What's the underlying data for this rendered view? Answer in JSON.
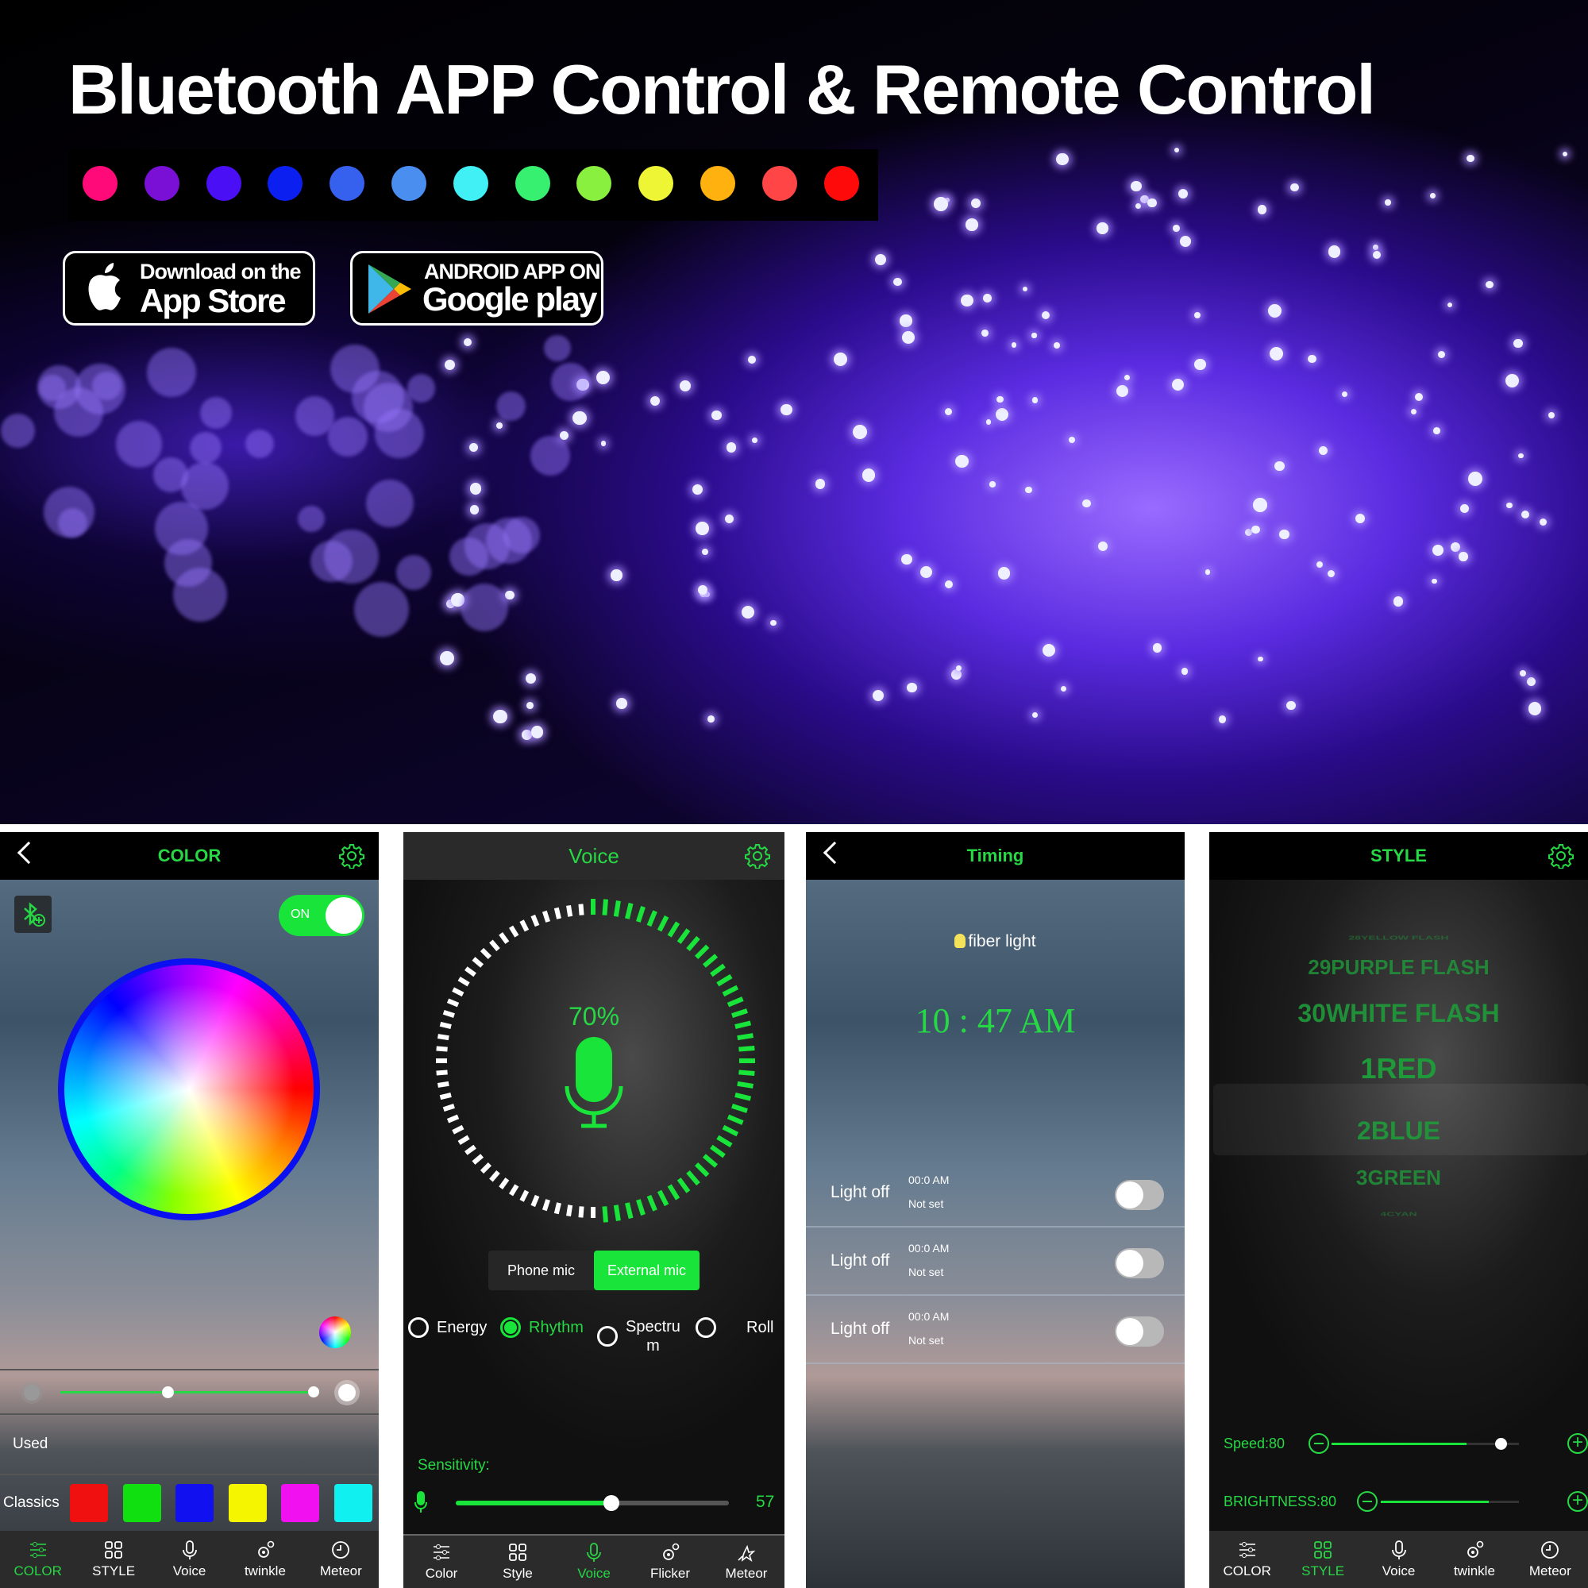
{
  "hero": {
    "title": "Bluetooth APP Control & Remote Control",
    "color_dots": [
      "#ff0a78",
      "#7a0fd6",
      "#4a0ff5",
      "#0a1ff0",
      "#3660ee",
      "#4a8ef0",
      "#40f0f5",
      "#38f070",
      "#8af040",
      "#eef535",
      "#ffb20f",
      "#ff4545",
      "#ff0a0a"
    ],
    "app_store": {
      "line1": "Download on the",
      "line2": "App Store"
    },
    "google_play": {
      "line1": "ANDROID APP ON",
      "line2": "Google play"
    }
  },
  "color_screen": {
    "title": "COLOR",
    "power_label": "ON",
    "power_on": true,
    "brightness": 0.98,
    "used_label": "Used",
    "classics_label": "Classics",
    "classics": [
      "#f01010",
      "#10e010",
      "#1010f0",
      "#f5f500",
      "#f010f0",
      "#10f0f0"
    ],
    "nav": [
      "COLOR",
      "STYLE",
      "Voice",
      "twinkle",
      "Meteor"
    ],
    "active": 0
  },
  "voice_screen": {
    "title": "Voice",
    "percent": "70%",
    "ring_fill": 0.5,
    "phone_mic": "Phone mic",
    "external_mic": "External mic",
    "modes": [
      "Energy",
      "Rhythm",
      "Spectru\nm",
      "Roll"
    ],
    "selected_mode": 1,
    "sensitivity_label": "Sensitivity:",
    "sensitivity": 57,
    "nav": [
      "Color",
      "Style",
      "Voice",
      "Flicker",
      "Meteor"
    ],
    "active": 2
  },
  "timing_screen": {
    "title": "Timing",
    "device": "fiber light",
    "time": "10 : 47 AM",
    "rows": [
      {
        "label": "Light off",
        "time": "00:0 AM",
        "status": "Not set"
      },
      {
        "label": "Light off",
        "time": "00:0 AM",
        "status": "Not set"
      },
      {
        "label": "Light off",
        "time": "00:0 AM",
        "status": "Not set"
      }
    ]
  },
  "style_screen": {
    "title": "STYLE",
    "items": [
      "28YELLOW FLASH",
      "29PURPLE FLASH",
      "30WHITE FLASH",
      "1RED",
      "2BLUE",
      "3GREEN",
      "4CYAN"
    ],
    "selected": 3,
    "speed_label": "Speed:80",
    "speed": 80,
    "brightness_label": "BRIGHTNESS:80",
    "brightness": 80,
    "nav": [
      "COLOR",
      "STYLE",
      "Voice",
      "twinkle",
      "Meteor"
    ],
    "active": 1
  },
  "colors": {
    "accent": "#27d845"
  }
}
